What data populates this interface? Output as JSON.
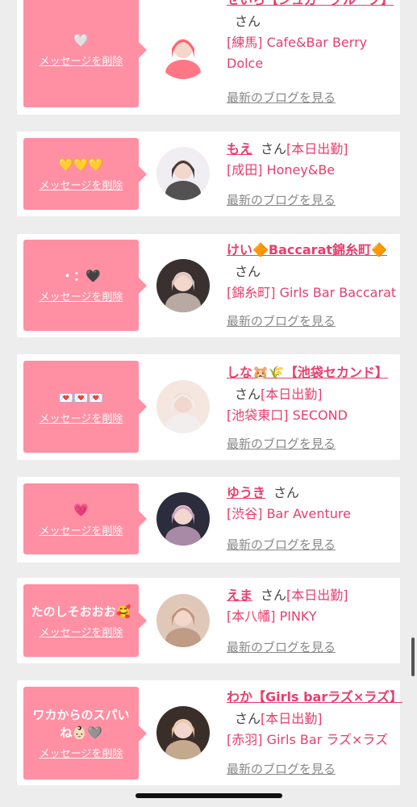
{
  "cards": [
    {
      "message": "🤍",
      "delete_label": "メッセージを削除",
      "name": "せいら【シュガーグループ】",
      "honorific": "さん",
      "today": "",
      "shop": "[練馬] Cafe&Bar Berry Dolce",
      "blog_label": "最新のブログを見る",
      "avatar_colors": [
        "#ffffff",
        "#ff5566"
      ]
    },
    {
      "message": "💛💛💛",
      "delete_label": "メッセージを削除",
      "name": "もえ",
      "honorific": "さん",
      "today": "[本日出勤]",
      "shop": "[成田] Honey&Be",
      "blog_label": "最新のブログを見る",
      "avatar_colors": [
        "#f0eef3",
        "#2a2a2a"
      ]
    },
    {
      "message": "・：🖤",
      "delete_label": "メッセージを削除",
      "name": "けい🔶Baccarat錦糸町🔶",
      "honorific": "さん",
      "today": "",
      "shop": "[錦糸町] Girls Bar Baccarat",
      "blog_label": "最新のブログを見る",
      "avatar_colors": [
        "#3a3030",
        "#d9c8c0"
      ]
    },
    {
      "message": "💌💌💌",
      "delete_label": "メッセージを削除",
      "name": "しな🐹🌾【池袋セカンド】",
      "honorific": "さん",
      "today": "[本日出勤]",
      "shop": "[池袋東口] SECOND",
      "blog_label": "最新のブログを見る",
      "avatar_colors": [
        "#f5e6e0",
        "#f0f0f0"
      ]
    },
    {
      "message": "💗",
      "delete_label": "メッセージを削除",
      "name": "ゆうき",
      "honorific": "さん",
      "today": "",
      "shop": "[渋谷] Bar Aventure",
      "blog_label": "最新のブログを見る",
      "avatar_colors": [
        "#2b2d3c",
        "#c8a0c0"
      ]
    },
    {
      "message": "たのしそおおお🥰",
      "delete_label": "メッセージを削除",
      "name": "えま",
      "honorific": "さん",
      "today": "[本日出勤]",
      "shop": "[本八幡] PINKY",
      "blog_label": "最新のブログを見る",
      "avatar_colors": [
        "#e0c8b8",
        "#b89078"
      ]
    },
    {
      "message": "ワカからのスパいね👶🏻🩶",
      "delete_label": "メッセージを削除",
      "name": "わか【Girls barラズ×ラズ】",
      "honorific": "さん",
      "today": "[本日出勤]",
      "shop": "[赤羽] Girls Bar ラズ×ラズ",
      "blog_label": "最新のブログを見る",
      "avatar_colors": [
        "#3a2e28",
        "#e8c8a8"
      ]
    }
  ]
}
